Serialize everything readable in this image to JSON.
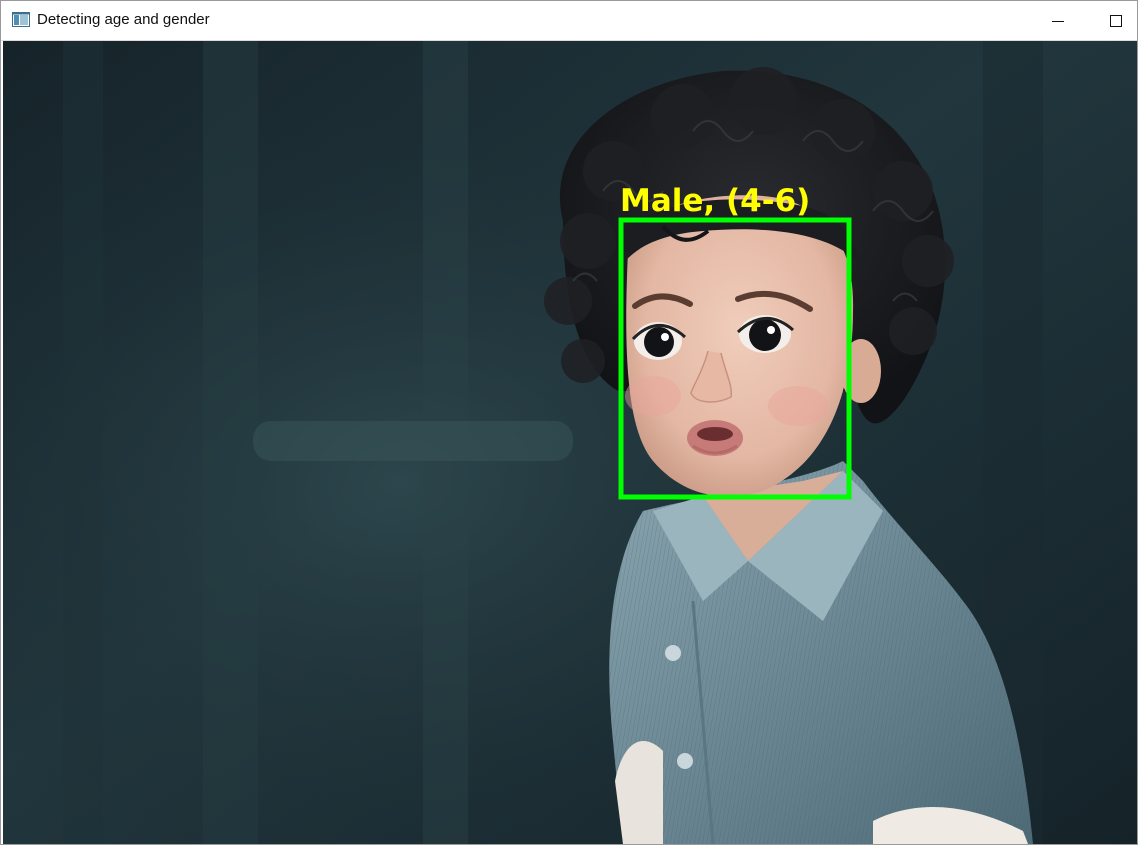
{
  "window": {
    "title": "Detecting age and gender",
    "icon": "app-window-icon",
    "controls": [
      {
        "name": "minimize-button",
        "glyph": "—"
      },
      {
        "name": "maximize-button",
        "glyph": "☐"
      }
    ]
  },
  "detection": {
    "label": "Male, (4-6)",
    "box_color": "#00ff00",
    "label_color": "#ffff00"
  },
  "colors": {
    "background_dark": "#1c2d33",
    "shirt": "#6f8d99",
    "skin": "#e7c2b0",
    "hair": "#1a1a1f"
  }
}
